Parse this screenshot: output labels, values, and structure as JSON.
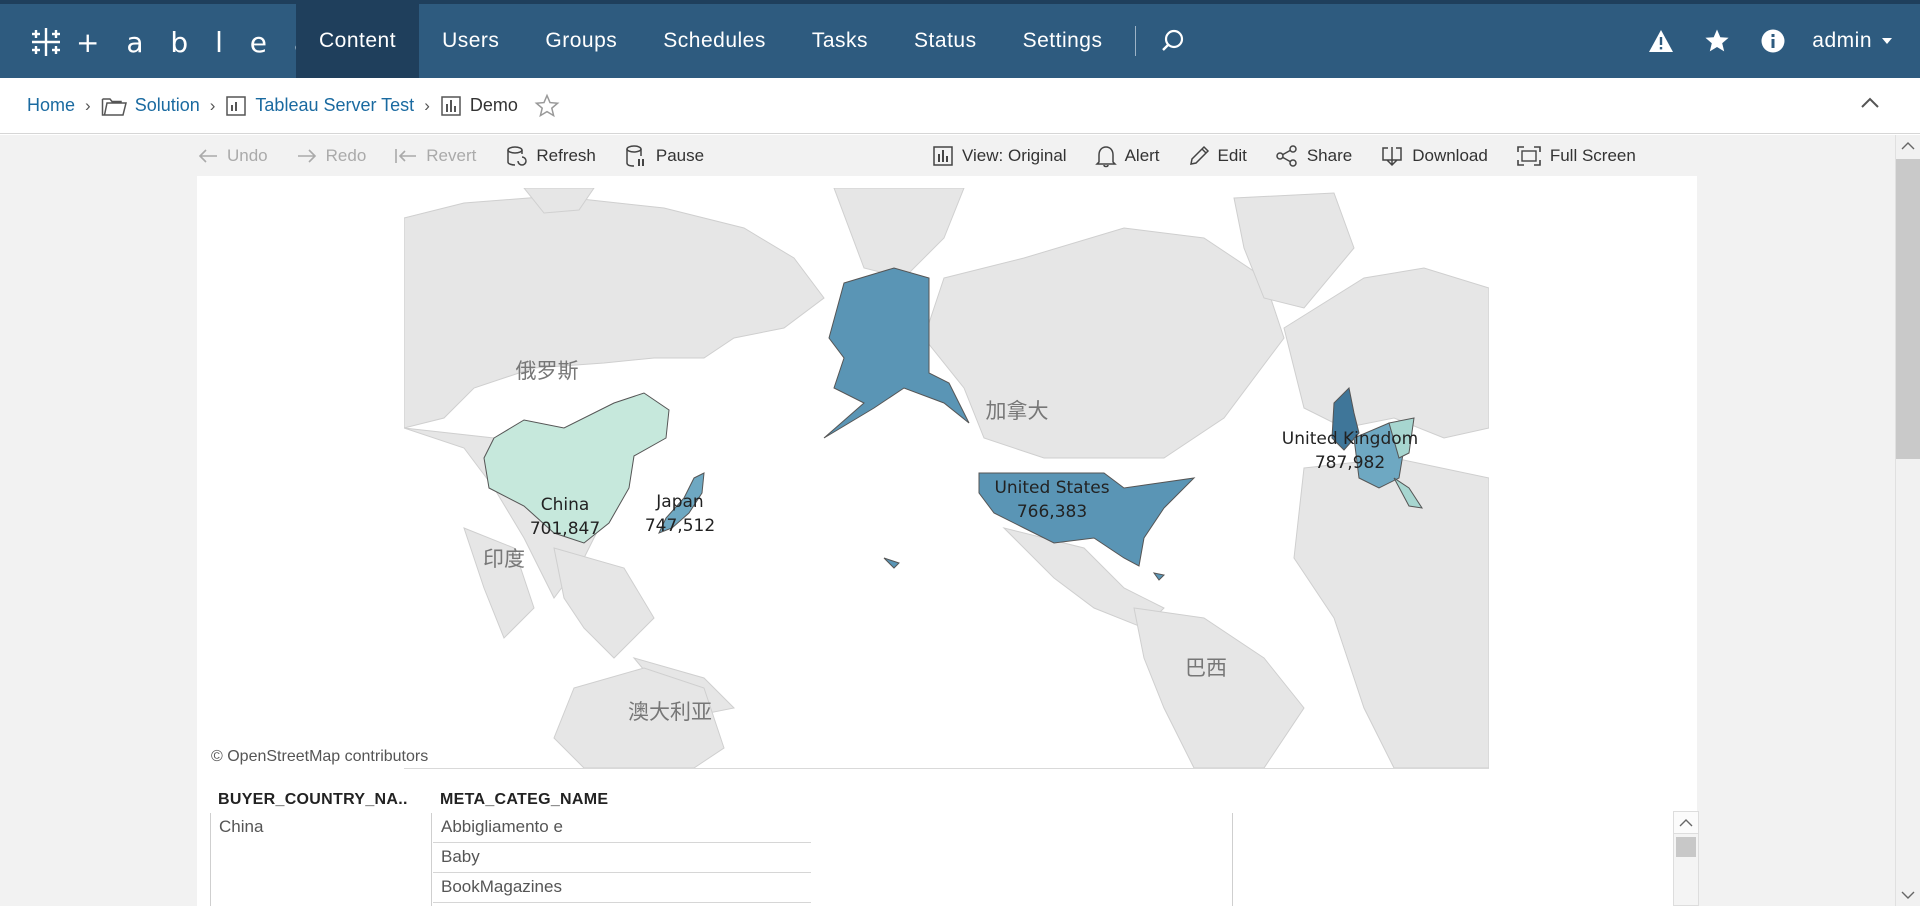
{
  "brand": {
    "logo_text": "+ a b l e a u"
  },
  "nav": {
    "tabs": [
      {
        "label": "Content"
      },
      {
        "label": "Users"
      },
      {
        "label": "Groups"
      },
      {
        "label": "Schedules"
      },
      {
        "label": "Tasks"
      },
      {
        "label": "Status"
      },
      {
        "label": "Settings"
      }
    ],
    "active_tab": "Content",
    "user": "admin"
  },
  "breadcrumb": {
    "items": [
      {
        "label": "Home",
        "icon": ""
      },
      {
        "label": "Solution",
        "icon": "folder-icon"
      },
      {
        "label": "Tableau Server Test",
        "icon": "workbook-icon"
      },
      {
        "label": "Demo",
        "icon": "sheet-icon"
      }
    ]
  },
  "toolbar": {
    "undo": "Undo",
    "redo": "Redo",
    "revert": "Revert",
    "refresh": "Refresh",
    "pause": "Pause",
    "view": "View: Original",
    "alert": "Alert",
    "edit": "Edit",
    "share": "Share",
    "download": "Download",
    "full_screen": "Full Screen"
  },
  "map": {
    "base_labels": {
      "russia": "俄罗斯",
      "canada": "加拿大",
      "india": "印度",
      "brazil": "巴西",
      "australia": "澳大利亚"
    },
    "countries": [
      {
        "name": "China",
        "value": "701,847",
        "color": "#c6e8dc"
      },
      {
        "name": "Japan",
        "value": "747,512",
        "color": "#6ea8c2"
      },
      {
        "name": "United States",
        "value": "766,383",
        "color": "#5a95b5"
      },
      {
        "name": "United Kingdom",
        "value": "787,982",
        "color": "#3f7699"
      }
    ],
    "attribution": "© OpenStreetMap contributors"
  },
  "table": {
    "headers": [
      "BUYER_COUNTRY_NA..",
      "META_CATEG_NAME"
    ],
    "country": "China",
    "categories": [
      "Abbigliamento e",
      "Baby",
      "BookMagazines"
    ]
  },
  "colors": {
    "nav_bg": "#2e5b7f",
    "nav_active": "#1f3f5c",
    "link": "#1a6aa0"
  }
}
